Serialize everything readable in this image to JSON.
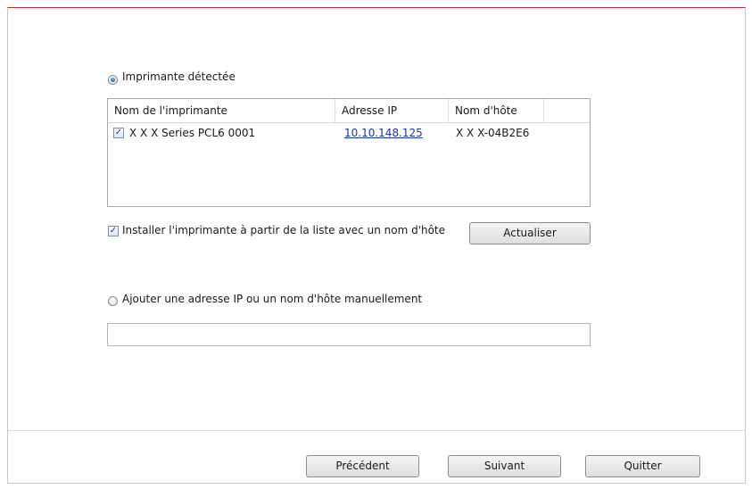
{
  "detected": {
    "label": "Imprimante détectée",
    "selected": true
  },
  "printer_list": {
    "columns": [
      "Nom de l'imprimante",
      "Adresse IP",
      "Nom d'hôte"
    ],
    "rows": [
      {
        "checked": true,
        "name": "X X X Series PCL6 0001",
        "ip": "10.10.148.125",
        "hostname": "X X X-04B2E6"
      }
    ]
  },
  "install_by_hostname": {
    "checked": true,
    "label": "Installer l'imprimante à partir de la liste avec un nom d'hôte"
  },
  "refresh_label": "Actualiser",
  "manual": {
    "label": "Ajouter une adresse IP ou un nom d'hôte manuellement",
    "selected": false,
    "value": ""
  },
  "footer": {
    "previous_label": "Précédent",
    "next_label": "Suivant",
    "quit_label": "Quitter"
  },
  "colors": {
    "accent_line": "#c0302a",
    "link": "#1a32b8"
  }
}
